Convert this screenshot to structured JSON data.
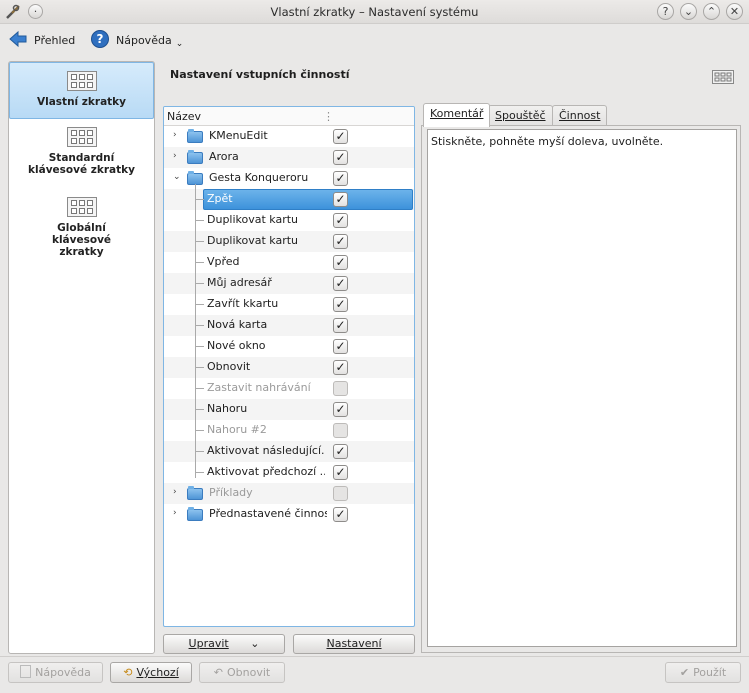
{
  "window": {
    "title": "Vlastní zkratky – Nastavení systému",
    "controls": [
      "?",
      "⌄",
      "⌃",
      "✕"
    ]
  },
  "toolbar": {
    "back_label": "Přehled",
    "help_label": "Nápověda"
  },
  "sidebar": {
    "items": [
      {
        "label": "Vlastní zkratky",
        "selected": true
      },
      {
        "label": "Standardní klávesové zkratky",
        "selected": false
      },
      {
        "label": "Globální klávesové zkratky",
        "selected": false
      }
    ]
  },
  "main": {
    "title": "Nastavení vstupních činností"
  },
  "tree": {
    "column_header": "Název",
    "rows": [
      {
        "label": "KMenuEdit",
        "level": 0,
        "folder": true,
        "checked": true,
        "enabled": true,
        "expand": "collapsed"
      },
      {
        "label": "Arora",
        "level": 0,
        "folder": true,
        "checked": true,
        "enabled": true,
        "expand": "collapsed"
      },
      {
        "label": "Gesta Konqueroru",
        "level": 0,
        "folder": true,
        "checked": true,
        "enabled": true,
        "expand": "expanded"
      },
      {
        "label": "Zpět",
        "level": 1,
        "folder": false,
        "checked": true,
        "enabled": true,
        "selected": true
      },
      {
        "label": "Duplikovat kartu",
        "level": 1,
        "folder": false,
        "checked": true,
        "enabled": true
      },
      {
        "label": "Duplikovat kartu",
        "level": 1,
        "folder": false,
        "checked": true,
        "enabled": true
      },
      {
        "label": "Vpřed",
        "level": 1,
        "folder": false,
        "checked": true,
        "enabled": true
      },
      {
        "label": "Můj adresář",
        "level": 1,
        "folder": false,
        "checked": true,
        "enabled": true
      },
      {
        "label": "Zavřít kkartu",
        "level": 1,
        "folder": false,
        "checked": true,
        "enabled": true
      },
      {
        "label": "Nová karta",
        "level": 1,
        "folder": false,
        "checked": true,
        "enabled": true
      },
      {
        "label": "Nové okno",
        "level": 1,
        "folder": false,
        "checked": true,
        "enabled": true
      },
      {
        "label": "Obnovit",
        "level": 1,
        "folder": false,
        "checked": true,
        "enabled": true
      },
      {
        "label": "Zastavit nahrávání",
        "level": 1,
        "folder": false,
        "checked": false,
        "enabled": false
      },
      {
        "label": "Nahoru",
        "level": 1,
        "folder": false,
        "checked": true,
        "enabled": true
      },
      {
        "label": "Nahoru #2",
        "level": 1,
        "folder": false,
        "checked": false,
        "enabled": false
      },
      {
        "label": "Aktivovat následující...",
        "level": 1,
        "folder": false,
        "checked": true,
        "enabled": true
      },
      {
        "label": "Aktivovat předchozí ...",
        "level": 1,
        "folder": false,
        "checked": true,
        "enabled": true
      },
      {
        "label": "Příklady",
        "level": 0,
        "folder": true,
        "checked": false,
        "enabled": false,
        "expand": "collapsed"
      },
      {
        "label": "Přednastavené činnosti",
        "level": 0,
        "folder": true,
        "checked": true,
        "enabled": true,
        "expand": "collapsed"
      }
    ],
    "edit_button": "Upravit",
    "settings_button": "Nastavení"
  },
  "tabs": {
    "items": [
      "Komentář",
      "Spouštěč",
      "Činnost"
    ],
    "active": 0,
    "comment_text": "Stiskněte, pohněte myší doleva, uvolněte."
  },
  "footer": {
    "help_label": "Nápověda",
    "defaults_label": "Výchozí",
    "reset_label": "Obnovit",
    "apply_label": "Použít"
  }
}
